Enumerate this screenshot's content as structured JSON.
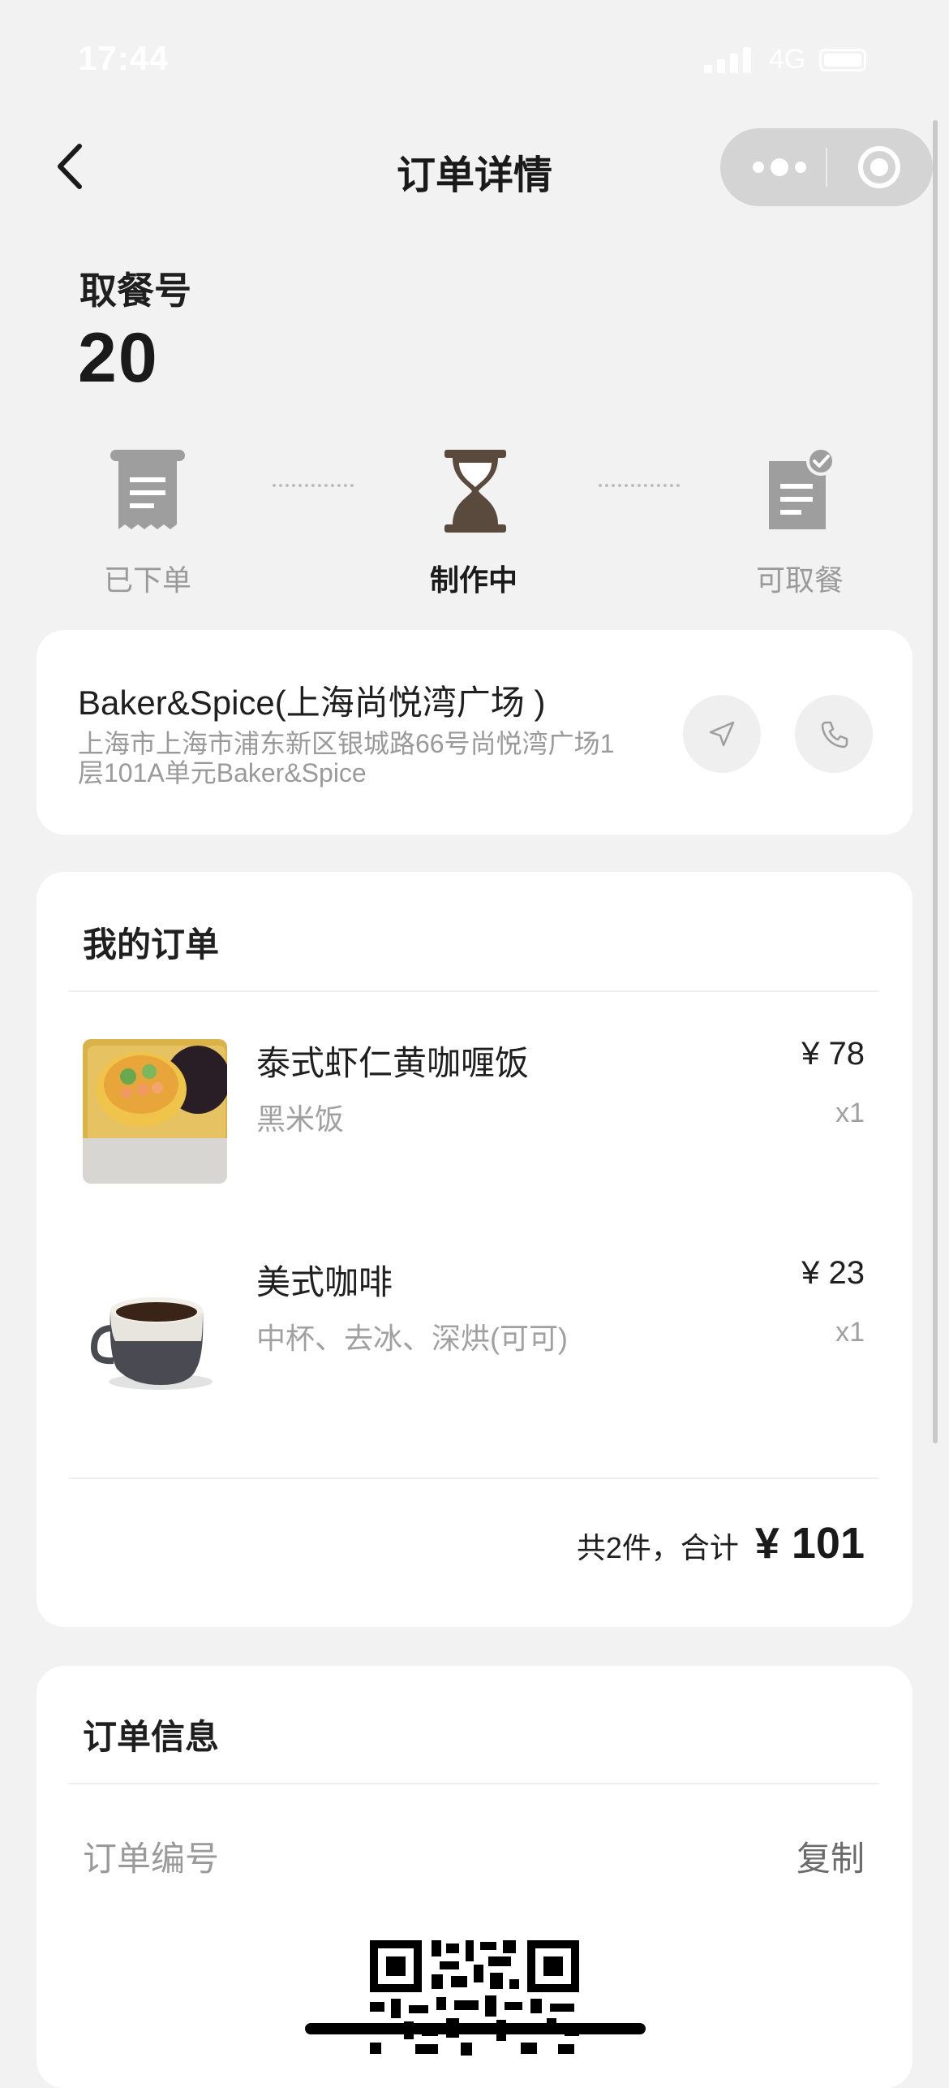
{
  "status_bar": {
    "time": "17:44",
    "network": "4G"
  },
  "nav": {
    "title": "订单详情"
  },
  "pickup": {
    "label": "取餐号",
    "number": "20"
  },
  "progress": {
    "steps": [
      {
        "label": "已下单",
        "icon": "receipt-icon"
      },
      {
        "label": "制作中",
        "icon": "hourglass-icon"
      },
      {
        "label": "可取餐",
        "icon": "ready-doc-icon"
      }
    ],
    "current_index": 1
  },
  "store": {
    "name": "Baker&Spice(上海尚悦湾广场 )",
    "address_line1": "上海市上海市浦东新区银城路66号尚悦湾广场1",
    "address_line2": "层101A单元Baker&Spice"
  },
  "order": {
    "title": "我的订单",
    "items": [
      {
        "name": "泰式虾仁黄咖喱饭",
        "options": "黑米饭",
        "price": "¥ 78",
        "qty": "x1"
      },
      {
        "name": "美式咖啡",
        "options": "中杯、去冰、深烘(可可)",
        "price": "¥ 23",
        "qty": "x1"
      }
    ],
    "summary_count": "共2件，合计",
    "summary_total": "¥ 101"
  },
  "info": {
    "title": "订单信息",
    "order_number_label": "订单编号",
    "copy_label": "复制"
  },
  "colors": {
    "background": "#f2f2f2",
    "card": "#ffffff",
    "accent_active": "#5a4a3e",
    "icon_gray": "#9e9e9e"
  }
}
